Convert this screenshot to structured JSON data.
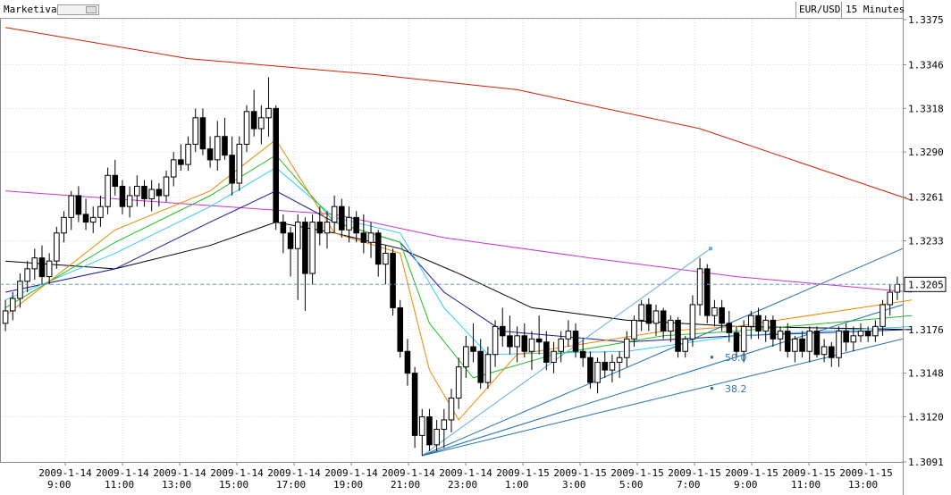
{
  "header": {
    "brand": "Marketiva",
    "symbol": "EUR/USD",
    "timeframe": "15 Minutes"
  },
  "colors": {
    "candle_up": "#ffffff",
    "candle_down": "#000000",
    "ma_red": "#cc2200",
    "ma_magenta": "#cc33cc",
    "ma_black": "#000000",
    "ma_navy": "#1a1a9c",
    "ma_cyan": "#33ccee",
    "ma_green": "#22bb22",
    "ma_orange": "#ee8800",
    "fan": "#1f6fb0",
    "price_line": "#7799cc"
  },
  "chart_data": {
    "type": "candlestick",
    "y_ticks": [
      "1.3375",
      "1.3346",
      "1.3318",
      "1.3290",
      "1.3261",
      "1.3233",
      "1.3205",
      "1.3176",
      "1.3148",
      "1.3120",
      "1.3091"
    ],
    "ylim": [
      1.3091,
      1.3375
    ],
    "current_price": "1.3205",
    "x_ticks": [
      {
        "date": "2009-1-14",
        "time": "9:00"
      },
      {
        "date": "2009-1-14",
        "time": "11:00"
      },
      {
        "date": "2009-1-14",
        "time": "13:00"
      },
      {
        "date": "2009-1-14",
        "time": "15:00"
      },
      {
        "date": "2009-1-14",
        "time": "17:00"
      },
      {
        "date": "2009-1-14",
        "time": "19:00"
      },
      {
        "date": "2009-1-14",
        "time": "21:00"
      },
      {
        "date": "2009-1-14",
        "time": "23:00"
      },
      {
        "date": "2009-1-15",
        "time": "1:00"
      },
      {
        "date": "2009-1-15",
        "time": "3:00"
      },
      {
        "date": "2009-1-15",
        "time": "5:00"
      },
      {
        "date": "2009-1-15",
        "time": "7:00"
      },
      {
        "date": "2009-1-15",
        "time": "9:00"
      },
      {
        "date": "2009-1-15",
        "time": "11:00"
      },
      {
        "date": "2009-1-15",
        "time": "13:00"
      }
    ],
    "fib_labels": [
      "50.0",
      "38.2"
    ],
    "candles": [
      [
        1.318,
        1.3195,
        1.3175,
        1.3188
      ],
      [
        1.3188,
        1.32,
        1.3182,
        1.3196
      ],
      [
        1.3196,
        1.3212,
        1.319,
        1.3207
      ],
      [
        1.3207,
        1.322,
        1.32,
        1.3215
      ],
      [
        1.3215,
        1.3228,
        1.3208,
        1.3222
      ],
      [
        1.3222,
        1.323,
        1.3205,
        1.321
      ],
      [
        1.321,
        1.3225,
        1.3205,
        1.322
      ],
      [
        1.322,
        1.3242,
        1.3215,
        1.3238
      ],
      [
        1.3238,
        1.3252,
        1.3232,
        1.3248
      ],
      [
        1.3248,
        1.3265,
        1.324,
        1.3262
      ],
      [
        1.3262,
        1.3268,
        1.3245,
        1.325
      ],
      [
        1.325,
        1.326,
        1.324,
        1.3245
      ],
      [
        1.3245,
        1.3255,
        1.3238,
        1.3248
      ],
      [
        1.3248,
        1.3262,
        1.3242,
        1.3255
      ],
      [
        1.3255,
        1.328,
        1.325,
        1.3275
      ],
      [
        1.3275,
        1.3285,
        1.3262,
        1.3268
      ],
      [
        1.3268,
        1.3272,
        1.325,
        1.3255
      ],
      [
        1.3255,
        1.3268,
        1.3248,
        1.3262
      ],
      [
        1.3262,
        1.3275,
        1.3255,
        1.3268
      ],
      [
        1.3268,
        1.3272,
        1.3255,
        1.326
      ],
      [
        1.326,
        1.3272,
        1.3252,
        1.3266
      ],
      [
        1.3266,
        1.327,
        1.3255,
        1.3262
      ],
      [
        1.3262,
        1.3278,
        1.3258,
        1.3274
      ],
      [
        1.3274,
        1.329,
        1.3268,
        1.3285
      ],
      [
        1.3285,
        1.3295,
        1.3278,
        1.3282
      ],
      [
        1.3282,
        1.33,
        1.3278,
        1.3295
      ],
      [
        1.3295,
        1.3318,
        1.329,
        1.3312
      ],
      [
        1.3312,
        1.3318,
        1.3288,
        1.3292
      ],
      [
        1.3292,
        1.33,
        1.328,
        1.3285
      ],
      [
        1.3285,
        1.331,
        1.3278,
        1.33
      ],
      [
        1.33,
        1.3312,
        1.3285,
        1.3288
      ],
      [
        1.3288,
        1.33,
        1.3262,
        1.327
      ],
      [
        1.327,
        1.33,
        1.3265,
        1.3295
      ],
      [
        1.3295,
        1.332,
        1.329,
        1.3316
      ],
      [
        1.3316,
        1.333,
        1.33,
        1.3305
      ],
      [
        1.3305,
        1.332,
        1.3295,
        1.3312
      ],
      [
        1.3312,
        1.3338,
        1.33,
        1.3318
      ],
      [
        1.3318,
        1.332,
        1.324,
        1.3245
      ],
      [
        1.3245,
        1.325,
        1.3225,
        1.3238
      ],
      [
        1.3238,
        1.3242,
        1.321,
        1.3228
      ],
      [
        1.3228,
        1.325,
        1.3195,
        1.3245
      ],
      [
        1.3245,
        1.3248,
        1.3188,
        1.3212
      ],
      [
        1.3212,
        1.325,
        1.3205,
        1.3245
      ],
      [
        1.3245,
        1.3255,
        1.323,
        1.3238
      ],
      [
        1.3238,
        1.3252,
        1.3228,
        1.3245
      ],
      [
        1.3245,
        1.3262,
        1.3238,
        1.3255
      ],
      [
        1.3255,
        1.326,
        1.3235,
        1.324
      ],
      [
        1.324,
        1.3255,
        1.3232,
        1.3248
      ],
      [
        1.3248,
        1.3252,
        1.3232,
        1.3238
      ],
      [
        1.3238,
        1.325,
        1.3225,
        1.3232
      ],
      [
        1.3232,
        1.3245,
        1.3222,
        1.3238
      ],
      [
        1.3238,
        1.324,
        1.321,
        1.3218
      ],
      [
        1.3218,
        1.323,
        1.3205,
        1.3225
      ],
      [
        1.3225,
        1.3228,
        1.3185,
        1.319
      ],
      [
        1.319,
        1.3195,
        1.3158,
        1.3162
      ],
      [
        1.3162,
        1.317,
        1.314,
        1.3148
      ],
      [
        1.3148,
        1.3152,
        1.31,
        1.3108
      ],
      [
        1.3108,
        1.3125,
        1.3095,
        1.312
      ],
      [
        1.312,
        1.3125,
        1.3098,
        1.3102
      ],
      [
        1.3102,
        1.3118,
        1.3098,
        1.3112
      ],
      [
        1.3112,
        1.3125,
        1.31,
        1.3118
      ],
      [
        1.3118,
        1.3138,
        1.311,
        1.3132
      ],
      [
        1.3132,
        1.3158,
        1.3125,
        1.3152
      ],
      [
        1.3152,
        1.3172,
        1.3145,
        1.3165
      ],
      [
        1.3165,
        1.318,
        1.3155,
        1.3162
      ],
      [
        1.3162,
        1.317,
        1.3138,
        1.3142
      ],
      [
        1.3142,
        1.3165,
        1.3138,
        1.316
      ],
      [
        1.316,
        1.3182,
        1.3152,
        1.3178
      ],
      [
        1.3178,
        1.319,
        1.3165,
        1.3172
      ],
      [
        1.3172,
        1.3185,
        1.316,
        1.3165
      ],
      [
        1.3165,
        1.3178,
        1.3155,
        1.3172
      ],
      [
        1.3172,
        1.318,
        1.3158,
        1.3162
      ],
      [
        1.3162,
        1.3175,
        1.315,
        1.317
      ],
      [
        1.317,
        1.3185,
        1.316,
        1.3168
      ],
      [
        1.3168,
        1.3175,
        1.315,
        1.3155
      ],
      [
        1.3155,
        1.3168,
        1.3148,
        1.3162
      ],
      [
        1.3162,
        1.3175,
        1.3155,
        1.317
      ],
      [
        1.317,
        1.3182,
        1.3165,
        1.3175
      ],
      [
        1.3175,
        1.318,
        1.3158,
        1.3162
      ],
      [
        1.3162,
        1.317,
        1.3152,
        1.3158
      ],
      [
        1.3158,
        1.3162,
        1.3138,
        1.3142
      ],
      [
        1.3142,
        1.3158,
        1.3135,
        1.3155
      ],
      [
        1.3155,
        1.3162,
        1.3145,
        1.315
      ],
      [
        1.315,
        1.316,
        1.3142,
        1.3155
      ],
      [
        1.3155,
        1.3162,
        1.3145,
        1.3158
      ],
      [
        1.3158,
        1.3175,
        1.3152,
        1.317
      ],
      [
        1.317,
        1.3185,
        1.3165,
        1.3182
      ],
      [
        1.3182,
        1.3195,
        1.3175,
        1.3192
      ],
      [
        1.3192,
        1.3196,
        1.3175,
        1.318
      ],
      [
        1.318,
        1.3192,
        1.3172,
        1.3188
      ],
      [
        1.3188,
        1.319,
        1.317,
        1.3175
      ],
      [
        1.3175,
        1.3185,
        1.3168,
        1.3182
      ],
      [
        1.3182,
        1.3184,
        1.3158,
        1.3162
      ],
      [
        1.3162,
        1.3172,
        1.3158,
        1.317
      ],
      [
        1.317,
        1.3198,
        1.3165,
        1.3192
      ],
      [
        1.3192,
        1.3222,
        1.3185,
        1.3215
      ],
      [
        1.3215,
        1.3218,
        1.318,
        1.3185
      ],
      [
        1.3185,
        1.3195,
        1.3178,
        1.319
      ],
      [
        1.319,
        1.3195,
        1.3175,
        1.318
      ],
      [
        1.318,
        1.3188,
        1.3168,
        1.3174
      ],
      [
        1.3174,
        1.3178,
        1.3158,
        1.3162
      ],
      [
        1.3162,
        1.3182,
        1.3155,
        1.3178
      ],
      [
        1.3178,
        1.3188,
        1.317,
        1.3185
      ],
      [
        1.3185,
        1.319,
        1.317,
        1.3175
      ],
      [
        1.3175,
        1.3185,
        1.3168,
        1.3182
      ],
      [
        1.3182,
        1.3185,
        1.3165,
        1.317
      ],
      [
        1.317,
        1.3178,
        1.3162,
        1.3175
      ],
      [
        1.3175,
        1.318,
        1.3158,
        1.3162
      ],
      [
        1.3162,
        1.3172,
        1.3155,
        1.317
      ],
      [
        1.317,
        1.3175,
        1.3158,
        1.3162
      ],
      [
        1.3162,
        1.3178,
        1.3155,
        1.3175
      ],
      [
        1.3175,
        1.3178,
        1.3158,
        1.316
      ],
      [
        1.316,
        1.317,
        1.3155,
        1.3165
      ],
      [
        1.3165,
        1.3168,
        1.3152,
        1.3158
      ],
      [
        1.3158,
        1.3178,
        1.3152,
        1.3175
      ],
      [
        1.3175,
        1.318,
        1.3162,
        1.3168
      ],
      [
        1.3168,
        1.3178,
        1.3162,
        1.3172
      ],
      [
        1.3172,
        1.318,
        1.3168,
        1.3175
      ],
      [
        1.3175,
        1.3178,
        1.3168,
        1.3172
      ],
      [
        1.3172,
        1.3182,
        1.3168,
        1.3178
      ],
      [
        1.3178,
        1.3195,
        1.3172,
        1.3192
      ],
      [
        1.3192,
        1.3205,
        1.3185,
        1.32
      ],
      [
        1.32,
        1.321,
        1.3195,
        1.3205
      ]
    ],
    "moving_averages": [
      {
        "color": "ma_red",
        "points": [
          [
            0,
            1.337
          ],
          [
            25,
            1.335
          ],
          [
            50,
            1.334
          ],
          [
            70,
            1.333
          ],
          [
            95,
            1.3305
          ],
          [
            124,
            1.3259
          ]
        ]
      },
      {
        "color": "ma_magenta",
        "points": [
          [
            0,
            1.3265
          ],
          [
            30,
            1.3255
          ],
          [
            45,
            1.325
          ],
          [
            60,
            1.3235
          ],
          [
            80,
            1.3222
          ],
          [
            100,
            1.321
          ],
          [
            124,
            1.32
          ]
        ]
      },
      {
        "color": "ma_black",
        "points": [
          [
            0,
            1.322
          ],
          [
            15,
            1.3215
          ],
          [
            28,
            1.323
          ],
          [
            37,
            1.3245
          ],
          [
            45,
            1.3238
          ],
          [
            54,
            1.3228
          ],
          [
            62,
            1.3212
          ],
          [
            72,
            1.319
          ],
          [
            85,
            1.3182
          ],
          [
            100,
            1.3178
          ],
          [
            124,
            1.3176
          ]
        ]
      },
      {
        "color": "ma_navy",
        "points": [
          [
            0,
            1.32
          ],
          [
            15,
            1.3215
          ],
          [
            28,
            1.3245
          ],
          [
            37,
            1.3265
          ],
          [
            45,
            1.3245
          ],
          [
            54,
            1.3232
          ],
          [
            60,
            1.32
          ],
          [
            68,
            1.3175
          ],
          [
            85,
            1.3168
          ],
          [
            100,
            1.3172
          ],
          [
            124,
            1.3176
          ]
        ]
      },
      {
        "color": "ma_cyan",
        "points": [
          [
            0,
            1.3195
          ],
          [
            15,
            1.3225
          ],
          [
            28,
            1.3255
          ],
          [
            37,
            1.328
          ],
          [
            45,
            1.3248
          ],
          [
            54,
            1.3238
          ],
          [
            60,
            1.319
          ],
          [
            66,
            1.316
          ],
          [
            85,
            1.3162
          ],
          [
            100,
            1.3172
          ],
          [
            124,
            1.3178
          ]
        ]
      },
      {
        "color": "ma_green",
        "points": [
          [
            0,
            1.319
          ],
          [
            15,
            1.3232
          ],
          [
            28,
            1.3262
          ],
          [
            37,
            1.3288
          ],
          [
            45,
            1.3245
          ],
          [
            54,
            1.3232
          ],
          [
            58,
            1.318
          ],
          [
            64,
            1.3145
          ],
          [
            75,
            1.316
          ],
          [
            90,
            1.3172
          ],
          [
            100,
            1.3175
          ],
          [
            124,
            1.3185
          ]
        ]
      },
      {
        "color": "ma_orange",
        "points": [
          [
            0,
            1.3185
          ],
          [
            15,
            1.324
          ],
          [
            28,
            1.3265
          ],
          [
            37,
            1.3298
          ],
          [
            45,
            1.3238
          ],
          [
            54,
            1.3225
          ],
          [
            58,
            1.315
          ],
          [
            62,
            1.3118
          ],
          [
            70,
            1.316
          ],
          [
            90,
            1.3175
          ],
          [
            100,
            1.3178
          ],
          [
            124,
            1.3195
          ]
        ]
      }
    ]
  }
}
